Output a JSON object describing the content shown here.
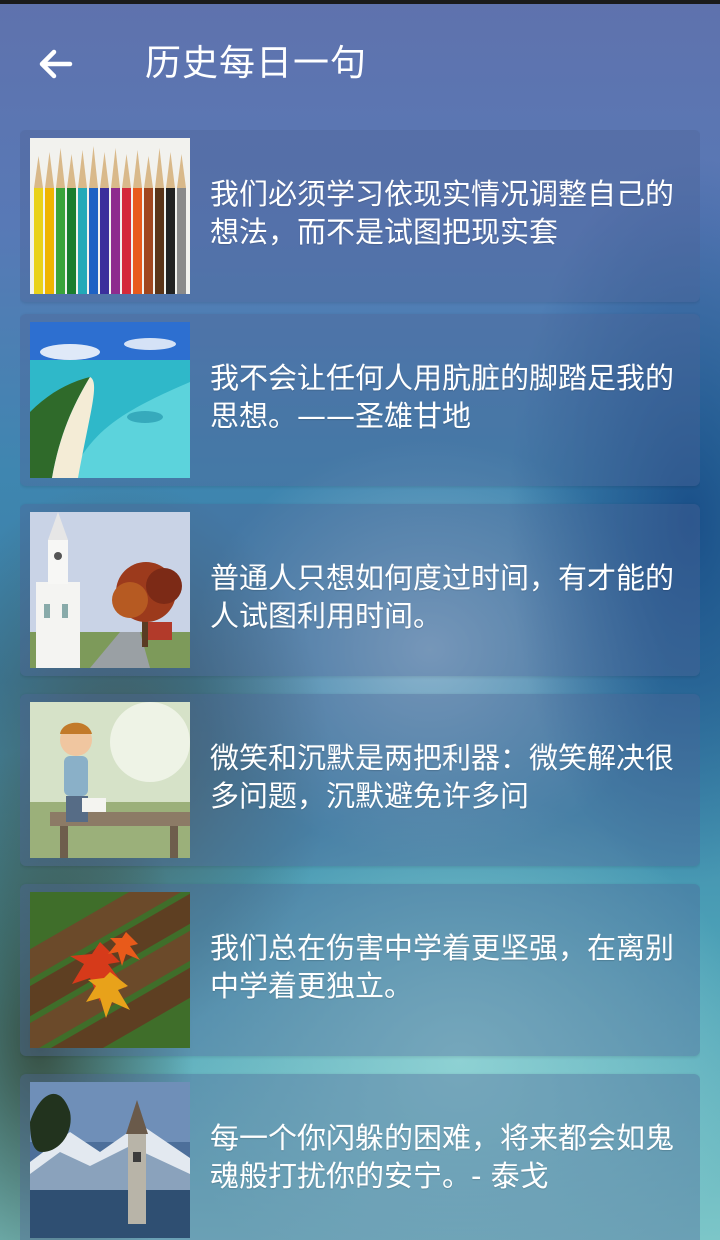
{
  "header": {
    "back_icon": "arrow-left-icon",
    "title": "历史每日一句"
  },
  "quotes": [
    {
      "text": "我们必须学习依现实情况调整自己的想法，而不是试图把现实套",
      "image": "colored-pencils-image"
    },
    {
      "text": "我不会让任何人用肮脏的脚踏足我的思想。——圣雄甘地",
      "image": "tropical-beach-image"
    },
    {
      "text": "普通人只想如何度过时间，有才能的人试图利用时间。",
      "image": "white-church-autumn-tree-image"
    },
    {
      "text": "微笑和沉默是两把利器：微笑解决很多问题，沉默避免许多问",
      "image": "laughing-child-bench-image"
    },
    {
      "text": "我们总在伤害中学着更坚强，在离别中学着更独立。",
      "image": "autumn-leaves-bench-image"
    },
    {
      "text": "每一个你闪躲的困难，将来都会如鬼魂般打扰你的安宁。- 泰戈",
      "image": "lake-bell-tower-image"
    }
  ],
  "colors": {
    "text": "#ffffff",
    "card": "rgba(80,100,150,0.38)"
  }
}
